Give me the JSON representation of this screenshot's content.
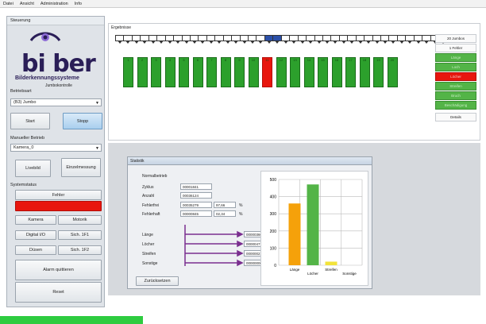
{
  "menu": [
    "Datei",
    "Ansicht",
    "Administration",
    "Info"
  ],
  "left": {
    "panel_title": "Steuerung",
    "logo_word": "bi ber",
    "logo_sub": "Bilderkennungssysteme",
    "logo_sub2": "Jumbokontrolle",
    "betriebsart_label": "Betriebsart",
    "betriebsart_value": "(B3) Jumbo",
    "start": "Start",
    "stopp": "Stopp",
    "manuell_label": "Manueller Betrieb",
    "kamera_value": "Kamera_0",
    "livebild": "Livebild",
    "einzelmessung": "Einzelmessung",
    "systemstatus_label": "Systemstatus",
    "fehler": "Fehler",
    "kamera": "Kamera",
    "motorik": "Motorik",
    "digital_io": "Digital I/O",
    "sich_1f1": "Sich. 1F1",
    "duesen": "Düsen",
    "sich_1f2": "Sich. 1F2",
    "alarm": "Alarm quittieren",
    "reset": "Reset"
  },
  "results": {
    "title": "Ergebnisse",
    "bar_labels": [
      "1",
      "2",
      "3",
      "4",
      "5",
      "6",
      "7",
      "8",
      "9",
      "10",
      "11",
      "12",
      "13",
      "14",
      "15",
      "16",
      "17",
      "18",
      "19",
      "20"
    ],
    "side": [
      "20 Jumbos",
      "1 Fehler",
      "Länge",
      "Loch",
      "Löcher",
      "Streifen",
      "Bruch",
      "Beschädigung",
      "Details"
    ]
  },
  "stats": {
    "title": "Statistik",
    "normal_label": "Normalbetrieb",
    "zyklus_label": "Zyklus",
    "zyklus": "00001841",
    "anzahl_label": "Anzahl",
    "anzahl": "00036124",
    "fehlerfrei_label": "Fehlerfrei",
    "fehlerfrei": "00035279",
    "fehlerfrei_pct": "97,66",
    "fehlerhaft_label": "Fehlerhaft",
    "fehlerhaft": "00000845",
    "fehlerhaft_pct": "02,34",
    "pct": "%",
    "laenge_label": "Länge",
    "laenge": "00000360",
    "loecher_label": "Löcher",
    "loecher": "00000471",
    "streifen_label": "Streifen",
    "streifen": "00000021",
    "sonstige_label": "Sonstige",
    "sonstige": "00000000",
    "zuruecksetzen": "Zurücksetzen"
  },
  "chart_data": {
    "type": "bar",
    "categories": [
      "Länge",
      "Löcher",
      "Streifen",
      "Sonstige"
    ],
    "values": [
      360,
      471,
      21,
      0
    ],
    "colors": [
      "#f5a10a",
      "#53b447",
      "#f2e33a",
      "#d0d0d0"
    ],
    "ylim": [
      0,
      500
    ],
    "yticks": [
      0,
      100,
      200,
      300,
      400,
      500
    ],
    "grid": true
  },
  "colors": {
    "accent_green": "#53b447",
    "accent_red": "#e8160e",
    "accent_blue": "#2b4fa8",
    "logo_purple": "#2a1e57"
  }
}
